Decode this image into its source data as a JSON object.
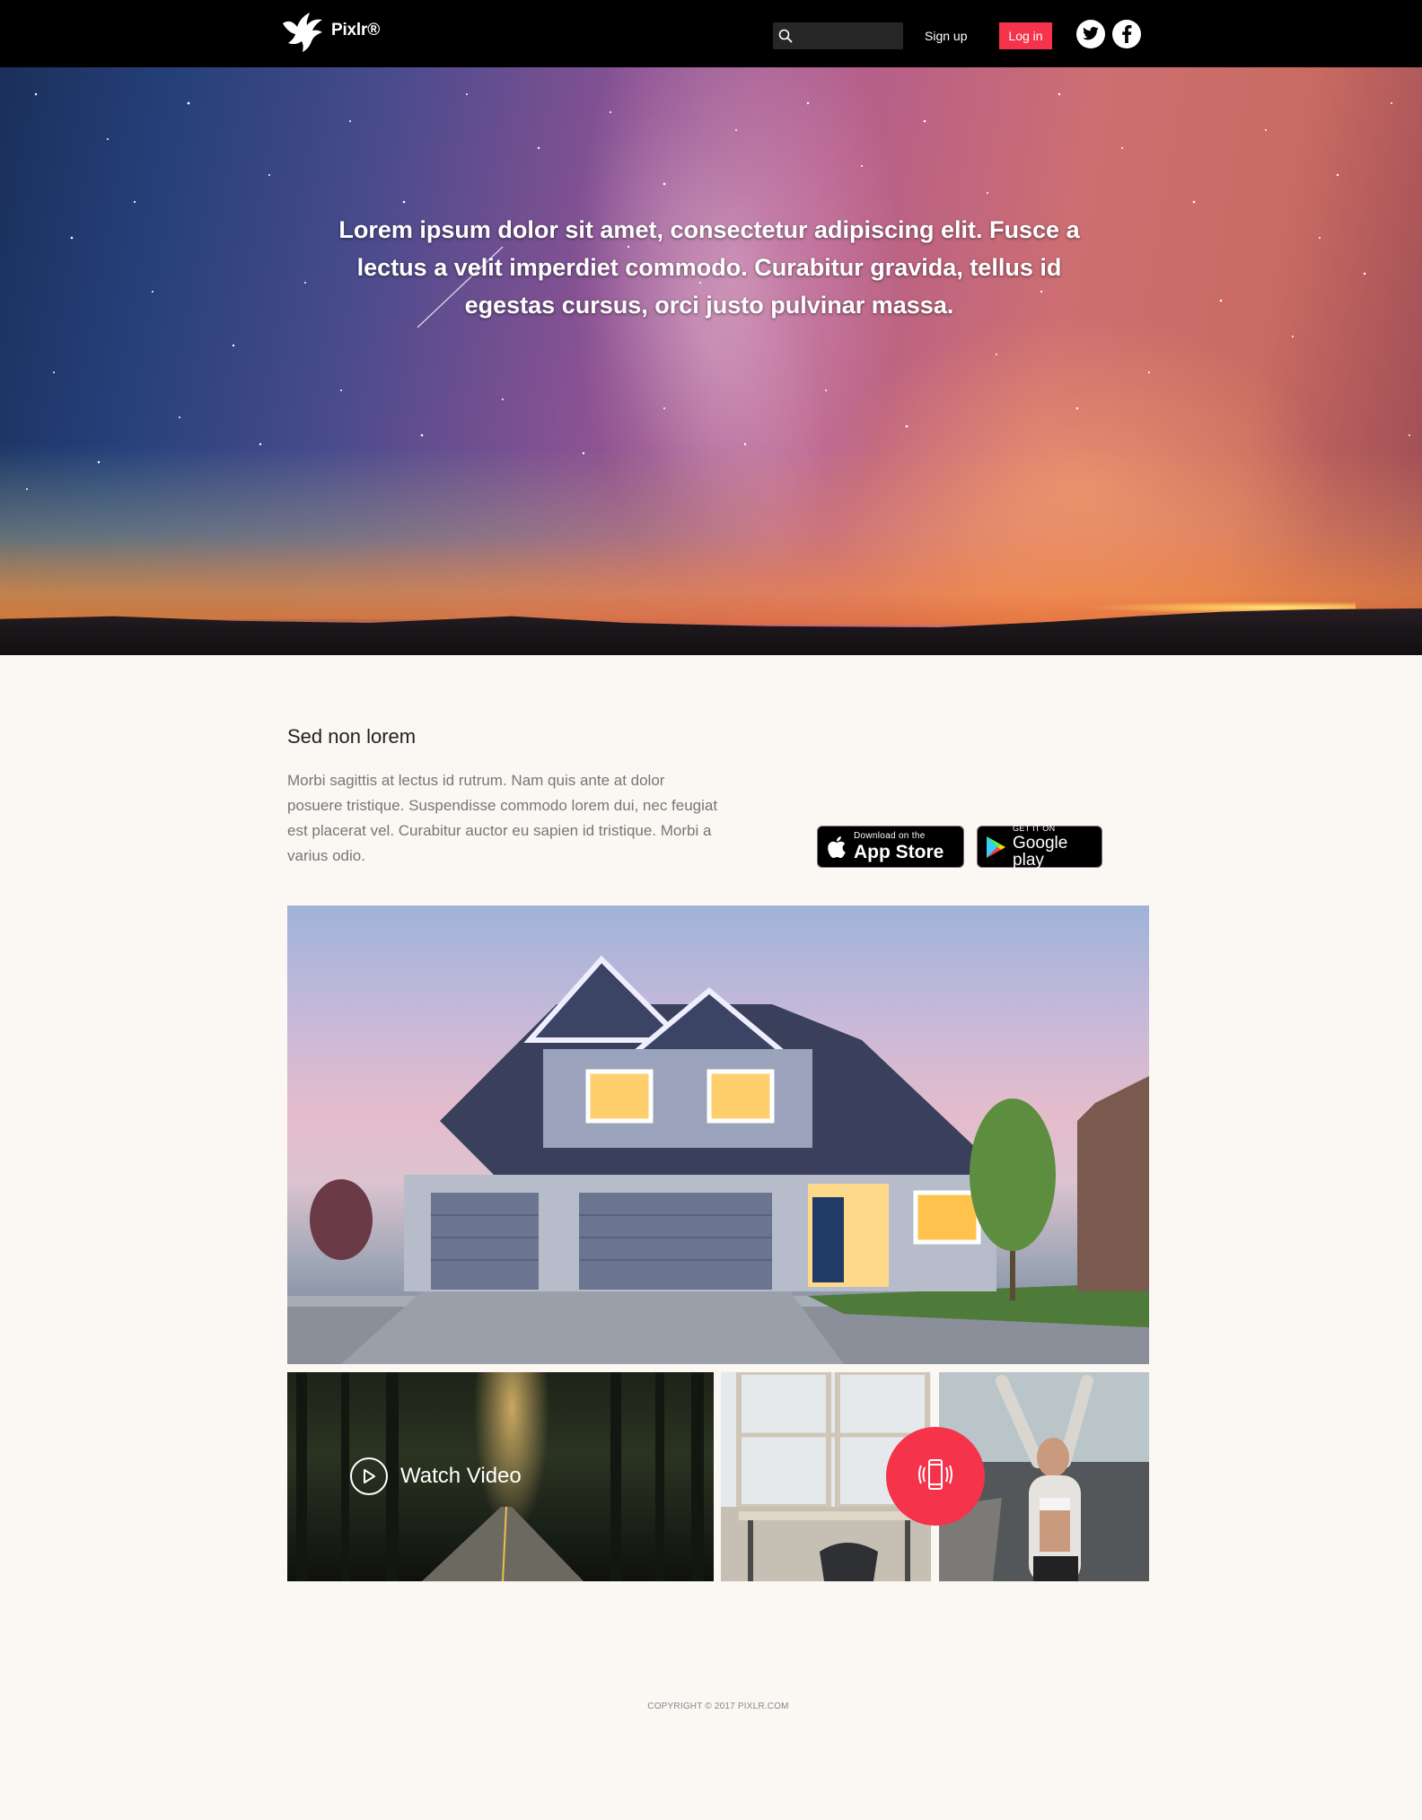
{
  "header": {
    "logo_text": "Pixlr®",
    "search_placeholder": "",
    "signup_label": "Sign up",
    "login_label": "Log in",
    "social": [
      "twitter-icon",
      "facebook-icon"
    ],
    "accent_color": "#f5334a"
  },
  "hero": {
    "text": "Lorem ipsum dolor sit amet, consectetur adipiscing elit. Fusce a lectus a velit imperdiet commodo. Curabitur gravida, tellus id egestas cursus, orci justo pulvinar massa."
  },
  "intro": {
    "title": "Sed non lorem",
    "body": "Morbi sagittis at lectus id rutrum. Nam quis ante at dolor posuere tristique. Suspendisse commodo lorem dui, nec feugiat est placerat vel. Curabitur auctor eu sapien id tristique. Morbi a varius odio."
  },
  "badges": {
    "appstore_small": "Download on the",
    "appstore_big": "App Store",
    "gplay_small": "GET IT ON",
    "gplay_big": "Google play"
  },
  "gallery": {
    "watch_video_label": "Watch Video"
  },
  "footer": {
    "copyright": "COPYRIGHT © 2017 PIXLR.COM"
  }
}
